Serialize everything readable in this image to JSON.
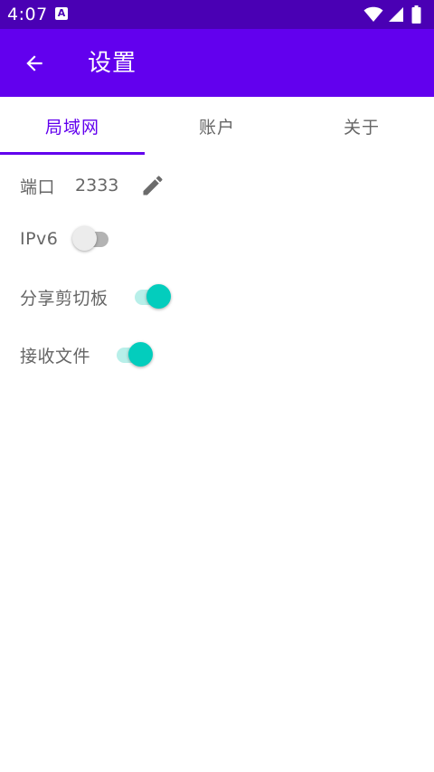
{
  "status_bar": {
    "time": "4:07",
    "notification_icon": "A",
    "icons": [
      "wifi-icon",
      "cellular-signal-icon",
      "battery-icon"
    ]
  },
  "app_bar": {
    "title": "设置",
    "back_icon": "arrow-back-icon"
  },
  "tabs": [
    {
      "label": "局域网",
      "active": true
    },
    {
      "label": "账户",
      "active": false
    },
    {
      "label": "关于",
      "active": false
    }
  ],
  "settings": {
    "port": {
      "label": "端口",
      "value": "2333",
      "edit_icon": "pencil-icon"
    },
    "ipv6": {
      "label": "IPv6",
      "enabled": false
    },
    "share_clipboard": {
      "label": "分享剪切板",
      "enabled": true
    },
    "receive_files": {
      "label": "接收文件",
      "enabled": true
    }
  },
  "colors": {
    "status_bar": "#4a00b4",
    "primary": "#6200ee",
    "accent": "#03cdbd",
    "accent_track": "#b8efe9",
    "text_secondary": "#666666"
  }
}
